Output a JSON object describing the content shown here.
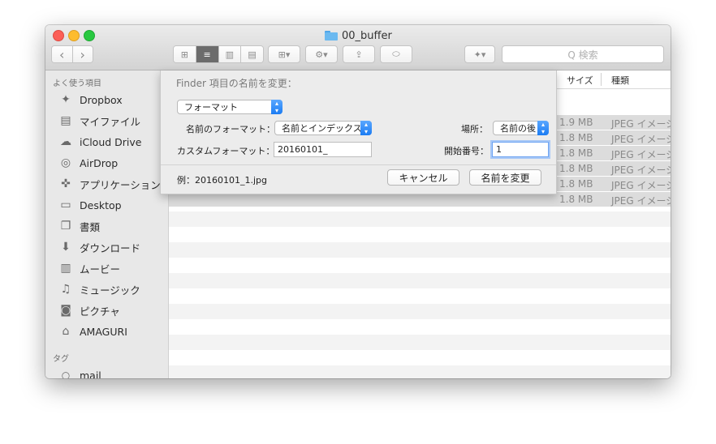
{
  "window": {
    "title": "00_buffer"
  },
  "toolbar": {
    "back": "‹",
    "forward": "›",
    "search_placeholder": "Q 検索",
    "views": [
      "⊞",
      "≡",
      "▥",
      "▤"
    ],
    "group_icon": "⊞▾",
    "action_icon": "⚙▾",
    "share_icon": "⇪",
    "tag_icon": "⬭",
    "dropbox_icon": "✦▾"
  },
  "sidebar": {
    "favorites_header": "よく使う項目",
    "items": [
      {
        "label": "Dropbox",
        "icon": "dropbox-icon"
      },
      {
        "label": "マイファイル",
        "icon": "myfiles-icon"
      },
      {
        "label": "iCloud Drive",
        "icon": "cloud-icon"
      },
      {
        "label": "AirDrop",
        "icon": "airdrop-icon"
      },
      {
        "label": "アプリケーション",
        "icon": "applications-icon"
      },
      {
        "label": "Desktop",
        "icon": "desktop-icon"
      },
      {
        "label": "書類",
        "icon": "documents-icon"
      },
      {
        "label": "ダウンロード",
        "icon": "downloads-icon"
      },
      {
        "label": "ムービー",
        "icon": "movies-icon"
      },
      {
        "label": "ミュージック",
        "icon": "music-icon"
      },
      {
        "label": "ピクチャ",
        "icon": "pictures-icon"
      },
      {
        "label": "AMAGURI",
        "icon": "home-icon"
      }
    ],
    "tags_header": "タグ",
    "tags": [
      {
        "label": "mail"
      }
    ]
  },
  "file_list": {
    "columns": {
      "size": "サイズ",
      "kind": "種類"
    },
    "rows": [
      {
        "size": "1.9 MB",
        "kind": "JPEG イメージ"
      },
      {
        "size": "1.8 MB",
        "kind": "JPEG イメージ"
      },
      {
        "size": "1.8 MB",
        "kind": "JPEG イメージ"
      },
      {
        "size": "1.8 MB",
        "kind": "JPEG イメージ"
      },
      {
        "size": "1.8 MB",
        "kind": "JPEG イメージ"
      },
      {
        "size": "1.8 MB",
        "kind": "JPEG イメージ"
      }
    ]
  },
  "rename_sheet": {
    "title": "Finder 項目の名前を変更：",
    "mode": "フォーマット",
    "name_format_label": "名前のフォーマット：",
    "name_format_value": "名前とインデックス",
    "location_label": "場所：",
    "location_value": "名前の後",
    "custom_format_label": "カスタムフォーマット：",
    "custom_format_value": "20160101_",
    "start_number_label": "開始番号：",
    "start_number_value": "1",
    "example": "例：20160101_1.jpg",
    "cancel": "キャンセル",
    "rename": "名前を変更"
  }
}
